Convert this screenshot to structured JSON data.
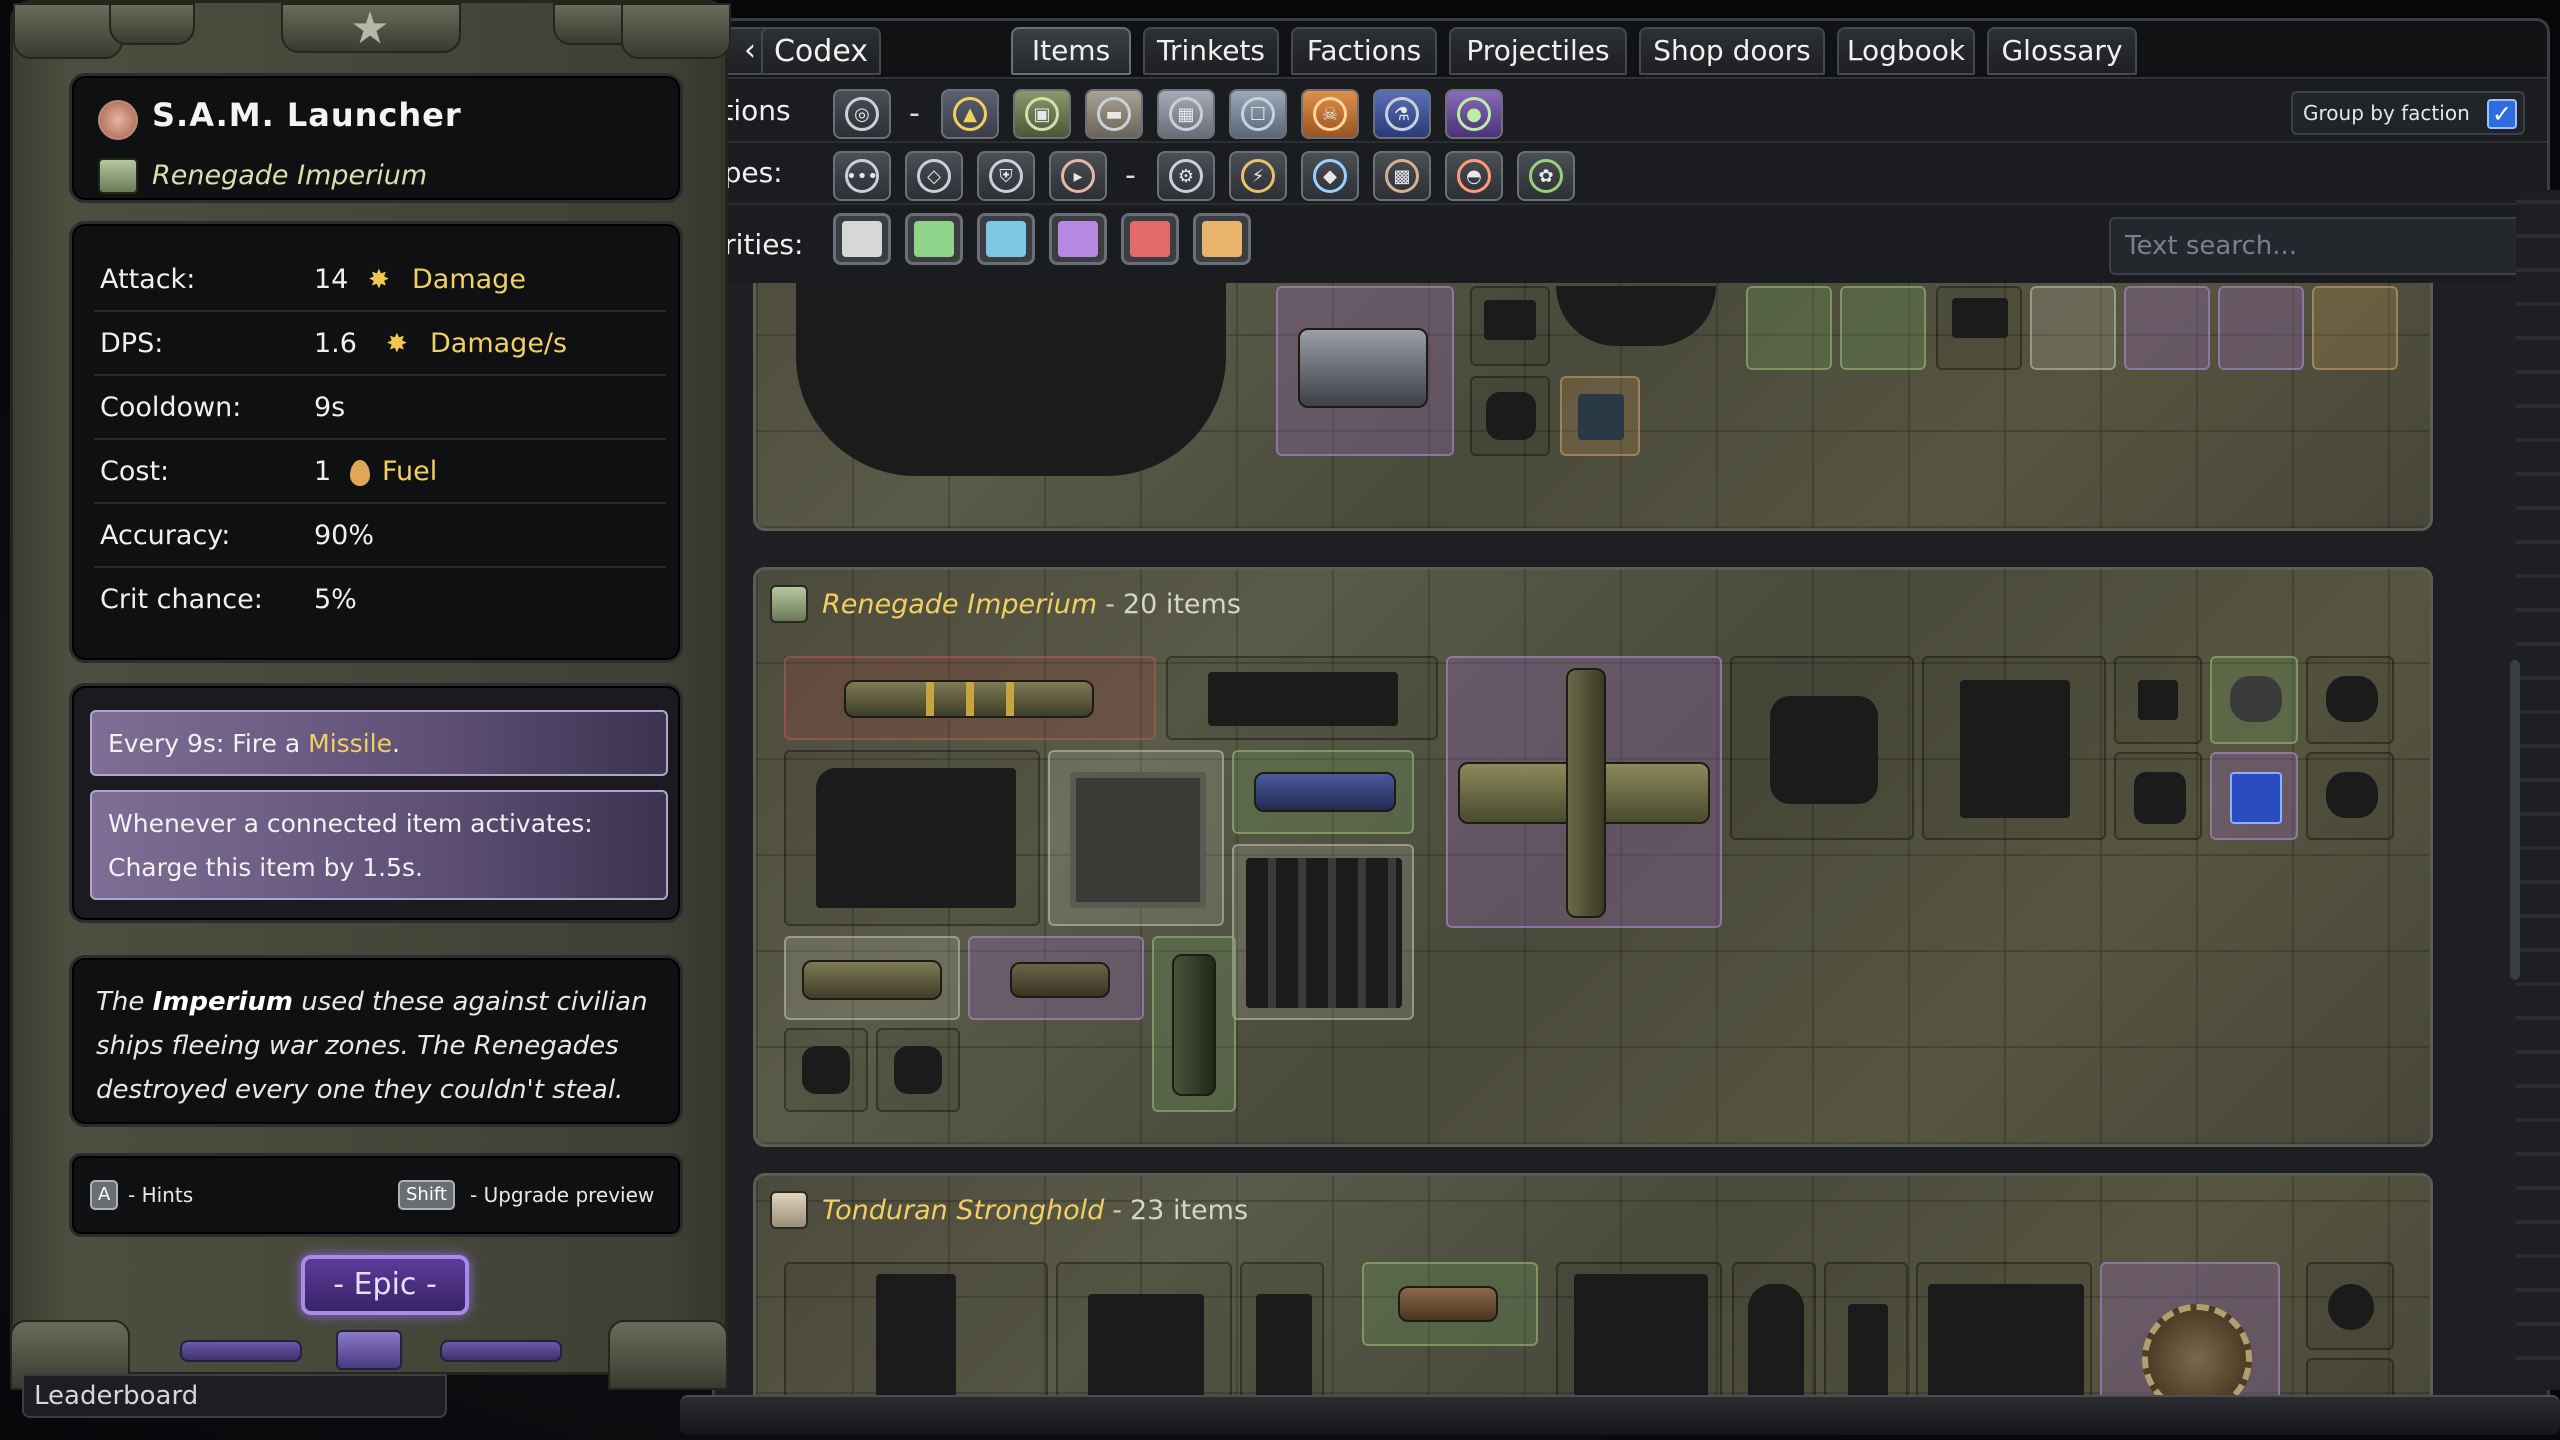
{
  "codex": {
    "title": "Codex",
    "back_icon": "chevron-left-icon",
    "tabs": [
      {
        "label": "Items",
        "active": true
      },
      {
        "label": "Trinkets"
      },
      {
        "label": "Factions"
      },
      {
        "label": "Projectiles"
      },
      {
        "label": "Shop doors"
      },
      {
        "label": "Logbook"
      },
      {
        "label": "Glossary"
      }
    ],
    "filters": {
      "factions_label": "ctions",
      "types_label": "ypes:",
      "rarities_label": "arities:",
      "dash": "-",
      "group_by_faction_label": "Group by faction",
      "group_by_faction_checked": "✓",
      "search_placeholder": "Text search..."
    },
    "rarity_colors": [
      "#d7d7d7",
      "#8fd48a",
      "#7ec8e6",
      "#b58ae0",
      "#e46a6a",
      "#e8b36a"
    ],
    "sections": [
      {
        "faction": "Renegade Imperium",
        "sep": "-",
        "count": "20 items"
      },
      {
        "faction": "Tonduran Stronghold",
        "sep": "-",
        "count": "23 items"
      }
    ]
  },
  "item": {
    "name": "S.A.M. Launcher",
    "faction": "Renegade Imperium",
    "stats": [
      {
        "label": "Attack:",
        "value": "14",
        "unit": "Damage",
        "icon": "burst-icon"
      },
      {
        "label": "DPS:",
        "value": "1.6",
        "unit": "Damage/s",
        "icon": "burst-icon"
      },
      {
        "label": "Cooldown:",
        "value": "9s"
      },
      {
        "label": "Cost:",
        "value": "1",
        "unit": "Fuel",
        "icon": "fuel-drop-icon"
      },
      {
        "label": "Accuracy:",
        "value": "90%"
      },
      {
        "label": "Crit chance:",
        "value": "5%"
      }
    ],
    "abilities": {
      "a1_pre": "Every 9s: Fire a ",
      "a1_hl": "Missile",
      "a1_post": ".",
      "a2_line1": "Whenever a connected item activates:",
      "a2_line2": "Charge this item by 1.5s."
    },
    "lore": {
      "p1": "The ",
      "imperium": "Imperium",
      "p2": " used these against civilian ships fleeing war zones. The Renegades destroyed every one they couldn't steal."
    },
    "hints": {
      "key_a": "A",
      "a_text": "- Hints",
      "key_shift": "Shift",
      "shift_text": "- Upgrade preview"
    },
    "rarity": "- Epic -"
  },
  "footer": {
    "leaderboard": "Leaderboard"
  }
}
